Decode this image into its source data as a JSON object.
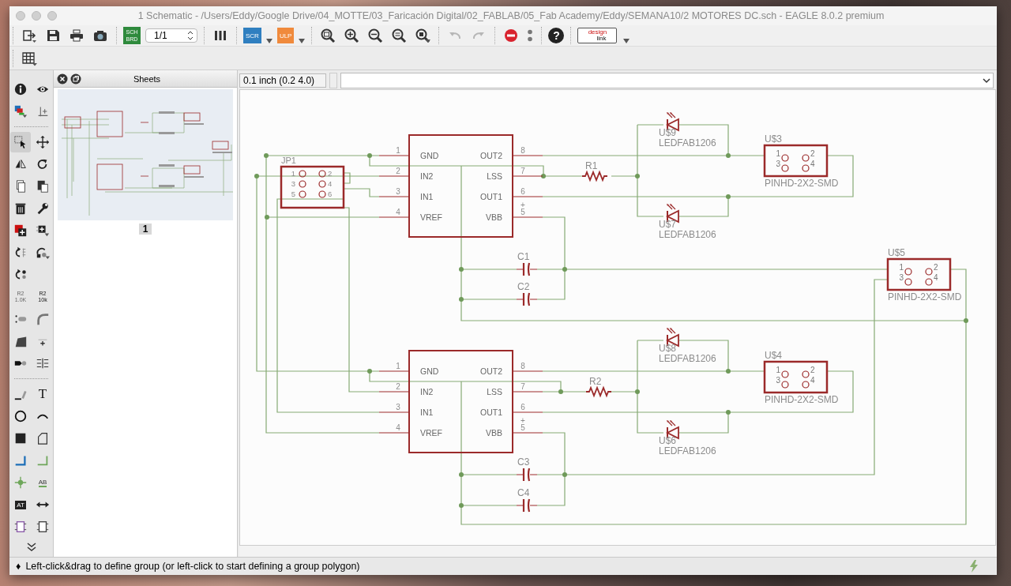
{
  "window": {
    "title": "1 Schematic - /Users/Eddy/Google Drive/04_MOTTE/03_Faricación Digital/02_FABLAB/05_Fab Academy/Eddy/SEMANA10/2 MOTORES DC.sch - EAGLE 8.0.2 premium"
  },
  "toolbar": {
    "groups": [
      {
        "items": [
          {
            "kind": "export",
            "disabled": false
          },
          {
            "kind": "save",
            "disabled": false
          },
          {
            "kind": "print",
            "disabled": false
          },
          {
            "kind": "camera",
            "disabled": false
          }
        ]
      },
      {
        "items": [
          {
            "kind": "sch-brd",
            "label": "SCH",
            "label_2": "BRD",
            "disabled": false
          },
          {
            "kind": "sheet-select",
            "value": "1/1",
            "disabled": false
          }
        ]
      },
      {
        "items": [
          {
            "kind": "layers",
            "disabled": false
          }
        ]
      },
      {
        "items": [
          {
            "kind": "script",
            "label": "SCR",
            "disabled": false
          },
          {
            "kind": "ulp",
            "label": "ULP",
            "disabled": false
          }
        ]
      },
      {
        "items": [
          {
            "kind": "zoom-fit",
            "disabled": false
          },
          {
            "kind": "zoom-in",
            "disabled": false
          },
          {
            "kind": "zoom-out",
            "disabled": false
          },
          {
            "kind": "zoom-select",
            "disabled": false
          },
          {
            "kind": "zoom-menu",
            "disabled": false
          }
        ]
      },
      {
        "items": [
          {
            "kind": "undo",
            "disabled": true
          },
          {
            "kind": "redo",
            "disabled": true
          }
        ]
      },
      {
        "items": [
          {
            "kind": "stop",
            "disabled": false
          },
          {
            "kind": "more",
            "disabled": false
          }
        ]
      },
      {
        "items": [
          {
            "kind": "help",
            "label": "?",
            "disabled": false
          }
        ]
      },
      {
        "items": [
          {
            "kind": "design-link",
            "label": "design",
            "label_2": "link",
            "disabled": false
          }
        ]
      }
    ]
  },
  "toolbar_2": {
    "items": [
      {
        "kind": "grid"
      }
    ]
  },
  "tools": {
    "groups": [
      {
        "rows": [
          [
            {
              "kind": "info",
              "selected": false
            },
            {
              "kind": "eye",
              "selected": false
            }
          ],
          [
            {
              "kind": "layers-color",
              "selected": false
            },
            {
              "kind": "mark",
              "selected": false
            }
          ]
        ]
      },
      {
        "rows": [
          [
            {
              "kind": "group",
              "selected": true
            },
            {
              "kind": "move",
              "selected": false
            }
          ],
          [
            {
              "kind": "mirror",
              "selected": false
            },
            {
              "kind": "rotate",
              "selected": false
            }
          ],
          [
            {
              "kind": "copy",
              "selected": false
            },
            {
              "kind": "paste",
              "selected": false
            }
          ],
          [
            {
              "kind": "delete",
              "selected": false
            },
            {
              "kind": "change",
              "selected": false
            }
          ],
          [
            {
              "kind": "add",
              "selected": false
            },
            {
              "kind": "replace",
              "selected": false
            }
          ],
          [
            {
              "kind": "gateswap",
              "selected": false
            },
            {
              "kind": "invoke",
              "selected": false
            }
          ],
          [
            {
              "kind": "pinswap",
              "selected": false
            }
          ],
          [
            {
              "kind": "name",
              "label": "R2",
              "label_2": "1.0K",
              "selected": false
            },
            {
              "kind": "value",
              "label": "R2",
              "label_2": "10k",
              "selected": false
            }
          ],
          [
            {
              "kind": "split",
              "selected": false
            },
            {
              "kind": "miter",
              "selected": false
            }
          ],
          [
            {
              "kind": "slice",
              "selected": false
            },
            {
              "kind": "optimize",
              "selected": false
            }
          ],
          [
            {
              "kind": "connect",
              "selected": false
            },
            {
              "kind": "errc",
              "selected": false
            }
          ]
        ]
      },
      {
        "rows": [
          [
            {
              "kind": "line",
              "selected": false
            },
            {
              "kind": "text",
              "label": "T",
              "selected": false
            }
          ],
          [
            {
              "kind": "circle",
              "selected": false
            },
            {
              "kind": "arc",
              "selected": false
            }
          ],
          [
            {
              "kind": "rect",
              "selected": false
            },
            {
              "kind": "polygon",
              "selected": false
            }
          ],
          [
            {
              "kind": "net",
              "selected": false
            },
            {
              "kind": "bus",
              "selected": false
            }
          ],
          [
            {
              "kind": "junction",
              "selected": false
            },
            {
              "kind": "label",
              "label": "AB",
              "selected": false
            }
          ],
          [
            {
              "kind": "attribute",
              "label": "AT",
              "selected": false
            },
            {
              "kind": "dimension",
              "selected": false
            }
          ],
          [
            {
              "kind": "frame",
              "selected": false
            },
            {
              "kind": "frame-alt",
              "selected": false
            }
          ]
        ]
      }
    ]
  },
  "sheets": {
    "title": "Sheets",
    "items": [
      {
        "label": "1",
        "selected": true
      }
    ]
  },
  "coordinates": "0.1 inch (0.2 4.0)",
  "schematic": {
    "drivers": [
      {
        "pins_left": [
          {
            "number": "1",
            "name": "GND"
          },
          {
            "number": "2",
            "name": "IN2"
          },
          {
            "number": "3",
            "name": "IN1"
          },
          {
            "number": "4",
            "name": "VREF"
          }
        ],
        "pins_right": [
          {
            "number": "8",
            "name": "OUT2"
          },
          {
            "number": "7",
            "name": "LSS"
          },
          {
            "number": "6",
            "name": "OUT1"
          },
          {
            "number": "5",
            "name": "VBB",
            "mark": "+"
          }
        ]
      },
      {
        "pins_left": [
          {
            "number": "1",
            "name": "GND"
          },
          {
            "number": "2",
            "name": "IN2"
          },
          {
            "number": "3",
            "name": "IN1"
          },
          {
            "number": "4",
            "name": "VREF"
          }
        ],
        "pins_right": [
          {
            "number": "8",
            "name": "OUT2"
          },
          {
            "number": "7",
            "name": "LSS"
          },
          {
            "number": "6",
            "name": "OUT1"
          },
          {
            "number": "5",
            "name": "VBB",
            "mark": "+"
          }
        ]
      }
    ],
    "header": {
      "name": "JP1",
      "pins": [
        "1",
        "2",
        "3",
        "4",
        "5",
        "6"
      ]
    },
    "resistors": [
      {
        "name": "R1"
      },
      {
        "name": "R2"
      }
    ],
    "capacitors": [
      {
        "name": "C1"
      },
      {
        "name": "C2"
      },
      {
        "name": "C3"
      },
      {
        "name": "C4"
      }
    ],
    "leds": [
      {
        "name": "U$9",
        "value": "LEDFAB1206"
      },
      {
        "name": "U$7",
        "value": "LEDFAB1206"
      },
      {
        "name": "U$8",
        "value": "LEDFAB1206"
      },
      {
        "name": "U$6",
        "value": "LEDFAB1206"
      }
    ],
    "connectors": [
      {
        "name": "U$3",
        "value": "PINHD-2X2-SMD",
        "pins": [
          "1",
          "2",
          "3",
          "4"
        ]
      },
      {
        "name": "U$5",
        "value": "PINHD-2X2-SMD",
        "pins": [
          "1",
          "2",
          "3",
          "4"
        ]
      },
      {
        "name": "U$4",
        "value": "PINHD-2X2-SMD",
        "pins": [
          "1",
          "2",
          "3",
          "4"
        ]
      }
    ]
  },
  "status_bar": {
    "icon": "♦",
    "message": "Left-click&drag to define group (or left-click to start defining a group polygon)"
  }
}
